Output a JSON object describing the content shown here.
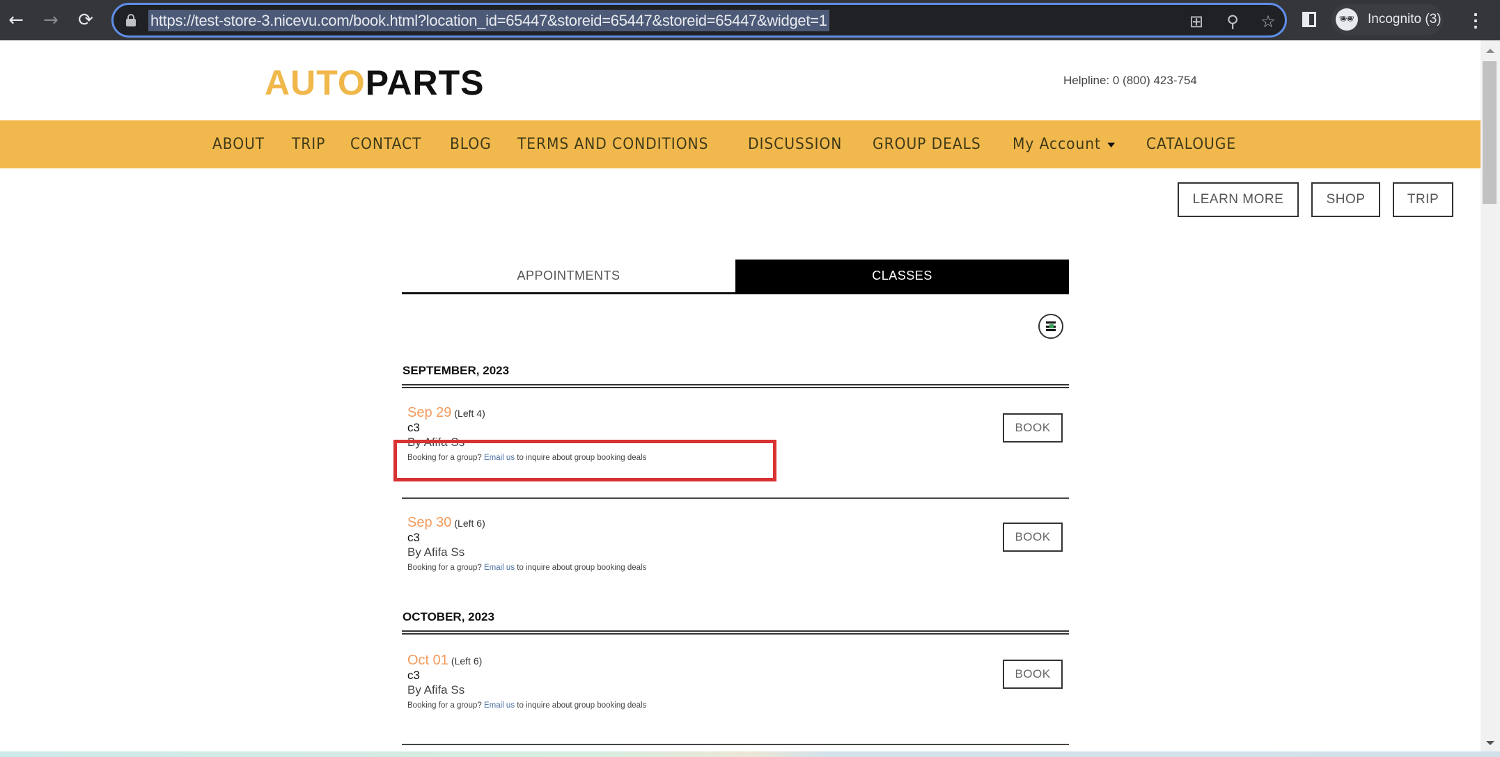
{
  "browser": {
    "url": "https://test-store-3.nicevu.com/book.html?location_id=65447&storeid=65447&storeid=65447&widget=1",
    "profile_label": "Incognito (3)",
    "icons": {
      "back": "arrow-left-icon",
      "forward": "arrow-right-icon",
      "reload": "reload-icon",
      "lock": "lock-icon",
      "install": "install-app-icon",
      "zoom": "zoom-icon",
      "bookmark": "star-icon",
      "side_panel": "side-panel-icon",
      "incognito": "incognito-icon",
      "menu": "kebab-menu-icon"
    },
    "glyphs": {
      "back": "←",
      "forward": "→",
      "reload": "⟳",
      "install": "⊞",
      "zoom": "⚲",
      "bookmark": "☆",
      "incognito": "🕶",
      "menu": "⋮"
    }
  },
  "header": {
    "logo_part1": "AUTO",
    "logo_part2": "PARTS",
    "helpline": "Helpline: 0 (800) 423-754"
  },
  "nav": {
    "items": [
      {
        "label": "ABOUT"
      },
      {
        "label": "TRIP"
      },
      {
        "label": "CONTACT"
      },
      {
        "label": "BLOG"
      },
      {
        "label": "TERMS AND CONDITIONS"
      },
      {
        "label": "DISCUSSION"
      },
      {
        "label": "GROUP DEALS"
      },
      {
        "label": "My Account",
        "has_dropdown": true
      },
      {
        "label": "CATALOUGE"
      }
    ]
  },
  "action_buttons": {
    "learn_more": "LEARN MORE",
    "shop": "SHOP",
    "trip": "TRIP"
  },
  "tabs": {
    "appointments": "APPOINTMENTS",
    "classes": "CLASSES",
    "active": "CLASSES"
  },
  "schedule": {
    "months": [
      {
        "label": "SEPTEMBER, 2023",
        "events": [
          {
            "date": "Sep 29",
            "left": "(Left 4)",
            "title": "c3",
            "by": "By Afifa Ss",
            "group_prefix": "Booking for a group?",
            "group_link": "Email us",
            "group_suffix": "to inquire about group booking deals",
            "book_label": "BOOK"
          },
          {
            "date": "Sep 30",
            "left": "(Left 6)",
            "title": "c3",
            "by": "By Afifa Ss",
            "group_prefix": "Booking for a group?",
            "group_link": "Email us",
            "group_suffix": "to inquire about group booking deals",
            "book_label": "BOOK"
          }
        ]
      },
      {
        "label": "OCTOBER, 2023",
        "events": [
          {
            "date": "Oct 01",
            "left": "(Left 6)",
            "title": "c3",
            "by": "By Afifa Ss",
            "group_prefix": "Booking for a group?",
            "group_link": "Email us",
            "group_suffix": "to inquire about group booking deals",
            "book_label": "BOOK"
          }
        ]
      }
    ]
  },
  "colors": {
    "brand_yellow": "#f1b84d",
    "date_orange": "#f39a5a",
    "link_blue": "#4a6fa5",
    "highlight_red": "#d93232",
    "omnibox_focus": "#5e8ee8"
  }
}
